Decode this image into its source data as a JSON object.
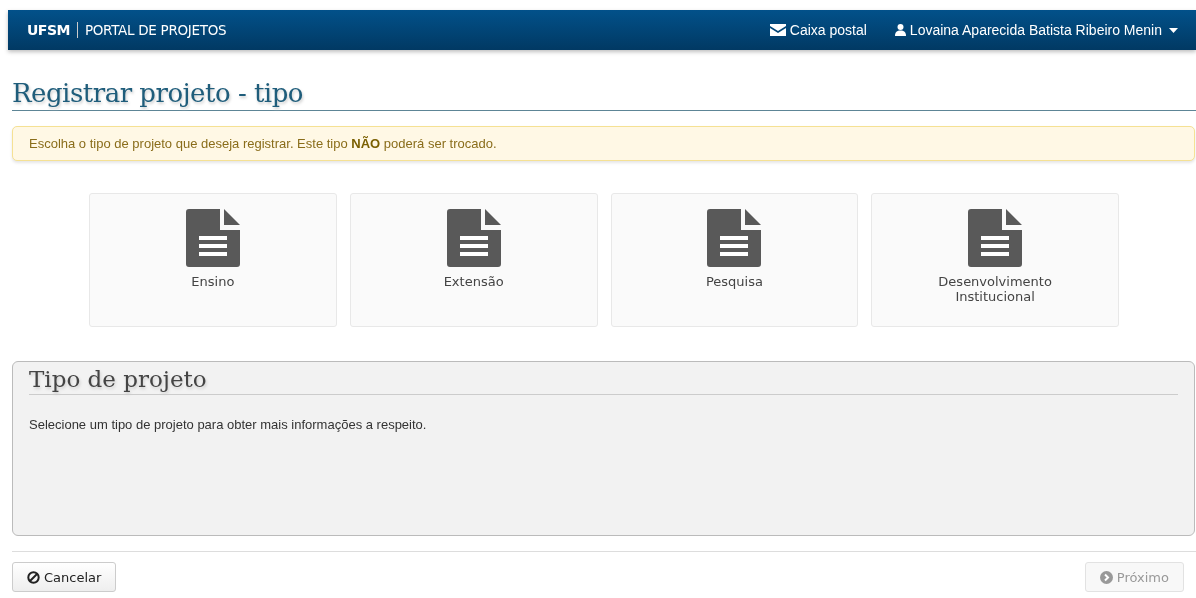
{
  "navbar": {
    "brand": "UFSM",
    "portal": "PORTAL DE PROJETOS",
    "mail": "Caixa postal",
    "user": "Lovaina Aparecida Batista Ribeiro Menin"
  },
  "title": "Registrar projeto - tipo",
  "alert": "Escolha o tipo de projeto que deseja registrar. Este tipo **NÃO** poderá ser trocado.",
  "types": [
    {
      "label": "Ensino",
      "selected": false
    },
    {
      "label": "Extensão",
      "selected": false
    },
    {
      "label": "Pesquisa",
      "selected": false
    },
    {
      "label": "Desenvolvimento Institucional",
      "selected": false
    }
  ],
  "panel": {
    "title": "Tipo de projeto",
    "text": "Selecione um tipo de projeto para obter mais informações a respeito."
  },
  "buttons": [
    {
      "kind": "cancel",
      "label": "Cancelar",
      "disabled": false
    },
    {
      "kind": "next",
      "label": "Próximo",
      "disabled": true
    }
  ]
}
